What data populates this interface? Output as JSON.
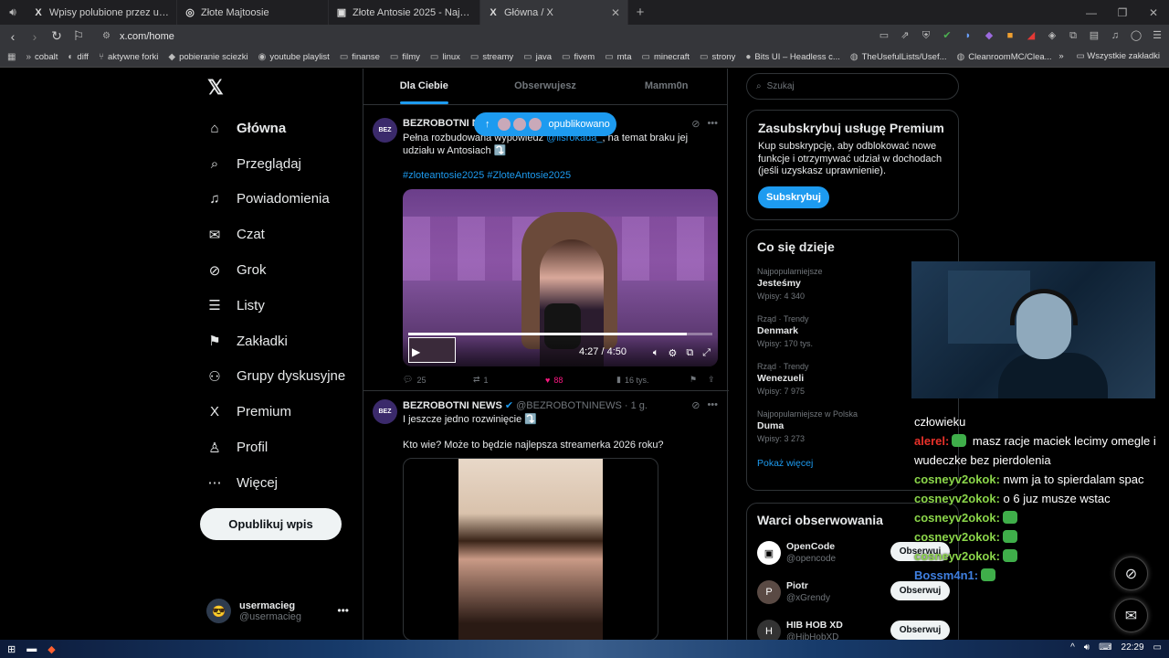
{
  "browser": {
    "tabs": [
      {
        "icon": "X",
        "label": "Wpisy polubione przez usermacieg (",
        "active": false
      },
      {
        "icon": "◎",
        "label": "Złote Majtoosie",
        "active": false
      },
      {
        "icon": "▣",
        "label": "Złote Antosie 2025 - Największy Plebi",
        "active": false
      },
      {
        "icon": "X",
        "label": "Główna / X",
        "active": true
      }
    ],
    "url": "x.com/home",
    "bookmarks": [
      {
        "icon": "»",
        "label": "cobalt"
      },
      {
        "icon": "◐",
        "label": "diff"
      },
      {
        "icon": "⑂",
        "label": "aktywne forki"
      },
      {
        "icon": "◆",
        "label": "pobieranie sciezki"
      },
      {
        "icon": "◉",
        "label": "youtube playlist"
      },
      {
        "icon": "▭",
        "label": "finanse"
      },
      {
        "icon": "▭",
        "label": "filmy"
      },
      {
        "icon": "▭",
        "label": "linux"
      },
      {
        "icon": "▭",
        "label": "streamy"
      },
      {
        "icon": "▭",
        "label": "java"
      },
      {
        "icon": "▭",
        "label": "fivem"
      },
      {
        "icon": "▭",
        "label": "mta"
      },
      {
        "icon": "▭",
        "label": "minecraft"
      },
      {
        "icon": "▭",
        "label": "strony"
      },
      {
        "icon": "●",
        "label": "Bits UI – Headless c..."
      },
      {
        "icon": "◍",
        "label": "TheUsefulLists/Usef..."
      },
      {
        "icon": "◍",
        "label": "CleanroomMC/Clea..."
      }
    ],
    "all_bookmarks": "Wszystkie zakładki"
  },
  "nav": {
    "items": [
      {
        "icon": "home-icon",
        "glyph": "⌂",
        "label": "Główna",
        "active": true
      },
      {
        "icon": "search-icon",
        "glyph": "⌕",
        "label": "Przeglądaj",
        "active": false
      },
      {
        "icon": "bell-icon",
        "glyph": "♫",
        "label": "Powiadomienia",
        "active": false
      },
      {
        "icon": "mail-icon",
        "glyph": "✉",
        "label": "Czat",
        "active": false
      },
      {
        "icon": "grok-icon",
        "glyph": "⊘",
        "label": "Grok",
        "active": false
      },
      {
        "icon": "list-icon",
        "glyph": "☰",
        "label": "Listy",
        "active": false
      },
      {
        "icon": "bookmark-icon",
        "glyph": "⚑",
        "label": "Zakładki",
        "active": false
      },
      {
        "icon": "groups-icon",
        "glyph": "⚇",
        "label": "Grupy dyskusyjne",
        "active": false
      },
      {
        "icon": "x-icon",
        "glyph": "X",
        "label": "Premium",
        "active": false
      },
      {
        "icon": "profile-icon",
        "glyph": "♙",
        "label": "Profil",
        "active": false
      },
      {
        "icon": "more-icon",
        "glyph": "⋯",
        "label": "Więcej",
        "active": false
      }
    ],
    "post_button": "Opublikuj wpis",
    "account": {
      "name": "usermacieg",
      "handle": "@usermacieg"
    }
  },
  "feed": {
    "tabs": [
      "Dla Ciebie",
      "Obserwujesz",
      "Mamm0n"
    ],
    "new_posts_pill": "opublikowano",
    "tweet1": {
      "avatar_text": "BEZ",
      "name": "BEZROBOTNI NEWS",
      "text_a": "Pełna rozbudowana wypowiedź ",
      "mention": "@lisrokada_",
      "text_b": ", na temat braku jej udziału w Antosiach ⤵️",
      "hashtags": "#zloteantosie2025 #ZloteAntosie2025",
      "video_time": "4:27 / 4:50",
      "video_progress": 0.917,
      "replies": "25",
      "reposts": "1",
      "likes": "88",
      "views": "16 tys."
    },
    "tweet2": {
      "avatar_text": "BEZ",
      "name": "BEZROBOTNI NEWS",
      "handle": "@BEZROBOTNINEWS · 1 g.",
      "text": "I jeszcze jedno rozwinięcie ⤵️",
      "text2": "Kto wie? Może to będzie najlepsza streamerka 2026 roku?"
    }
  },
  "sidebar": {
    "search_placeholder": "Szukaj",
    "premium": {
      "title": "Zasubskrybuj usługę Premium",
      "body": "Kup subskrypcję, aby odblokować nowe funkcje i otrzymywać udział w dochodach (jeśli uzyskasz uprawnienie).",
      "button": "Subskrybuj"
    },
    "trends": {
      "title": "Co się dzieje",
      "items": [
        {
          "context": "Najpopularniejsze",
          "title": "Jesteśmy",
          "count": "Wpisy: 4 340"
        },
        {
          "context": "Rząd · Trendy",
          "title": "Denmark",
          "count": "Wpisy: 170 tys."
        },
        {
          "context": "Rząd · Trendy",
          "title": "Wenezueli",
          "count": "Wpisy: 7 975"
        },
        {
          "context": "Najpopularniejsze w Polska",
          "title": "Duma",
          "count": "Wpisy: 3 273"
        }
      ],
      "show_more": "Pokaż więcej"
    },
    "who_to_follow": {
      "title": "Warci obserwowania",
      "items": [
        {
          "name": "OpenCode",
          "handle": "@opencode",
          "avatar": "▣"
        },
        {
          "name": "Piotr",
          "handle": "@xGrendy",
          "avatar": "P"
        },
        {
          "name": "HIB HOB XD",
          "handle": "@HibHobXD",
          "avatar": "H"
        }
      ],
      "button": "Obserwuj"
    }
  },
  "chat": [
    {
      "user": "",
      "color": "#ffffff",
      "text": "człowieku"
    },
    {
      "user": "alerel:",
      "color": "#e8312a",
      "text": " masz racje maciek lecimy omegle i wudeczke bez pierdolenia",
      "emote": true
    },
    {
      "user": "cosneyv2okok:",
      "color": "#8bd64a",
      "text": " nwm ja to spierdalam spac"
    },
    {
      "user": "cosneyv2okok:",
      "color": "#8bd64a",
      "text": " o 6 juz musze wstac"
    },
    {
      "user": "cosneyv2okok:",
      "color": "#8bd64a",
      "text": "",
      "emote": true
    },
    {
      "user": "cosneyv2okok:",
      "color": "#8bd64a",
      "text": "",
      "emote": true
    },
    {
      "user": "cosneyv2okok:",
      "color": "#8bd64a",
      "text": "",
      "emote": true
    },
    {
      "user": "Bossm4n1:",
      "color": "#3f7fe0",
      "text": "",
      "emote": true
    }
  ],
  "taskbar": {
    "time": "22:29"
  }
}
